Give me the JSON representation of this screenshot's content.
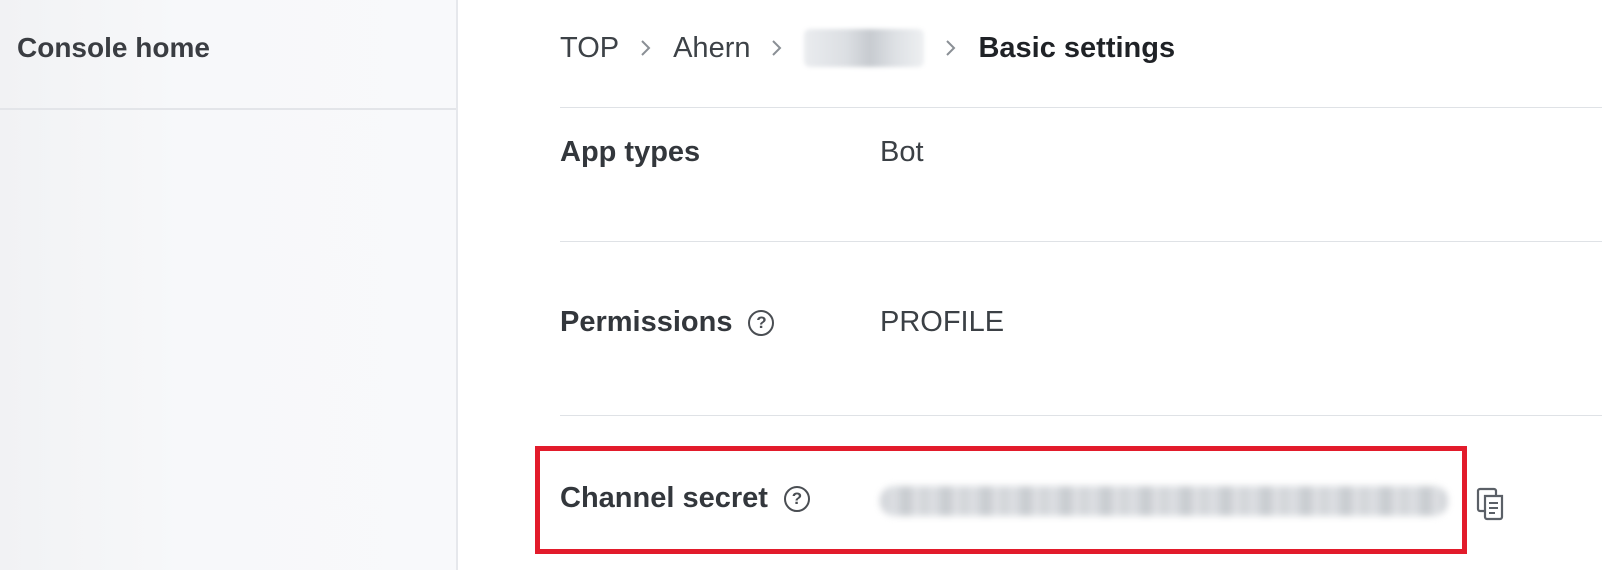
{
  "sidebar": {
    "title": "Console home"
  },
  "breadcrumb": {
    "items": [
      "TOP",
      "Ahern"
    ],
    "current": "Basic settings"
  },
  "settings": {
    "app_types": {
      "label": "App types",
      "value": "Bot"
    },
    "permissions": {
      "label": "Permissions",
      "value": "PROFILE",
      "help_icon": "question-circle-icon"
    },
    "channel_secret": {
      "label": "Channel secret",
      "help_icon": "question-circle-icon",
      "copy_icon": "copy-icon"
    }
  },
  "colors": {
    "highlight": "#e21b2b",
    "sidebar_bg": "#f7f8fa"
  }
}
